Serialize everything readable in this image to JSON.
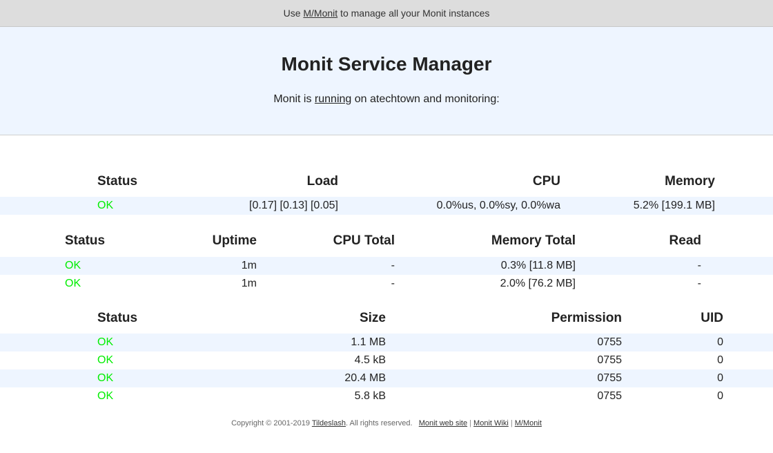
{
  "topbar": {
    "prefix": "Use ",
    "link": "M/Monit",
    "suffix": " to manage all your Monit instances"
  },
  "header": {
    "title": "Monit Service Manager",
    "sub_prefix": "Monit is ",
    "sub_link": "running",
    "sub_suffix": " on atechtown and monitoring:"
  },
  "system_table": {
    "headers": [
      "Status",
      "Load",
      "CPU",
      "Memory"
    ],
    "rows": [
      {
        "status": "OK",
        "load": "[0.17] [0.13] [0.05]",
        "cpu": "0.0%us, 0.0%sy, 0.0%wa",
        "memory": "5.2% [199.1 MB]"
      }
    ]
  },
  "process_table": {
    "headers": [
      "Status",
      "Uptime",
      "CPU Total",
      "Memory Total",
      "Read"
    ],
    "rows": [
      {
        "status": "OK",
        "uptime": "1m",
        "cpu_total": "-",
        "memory_total": "0.3% [11.8 MB]",
        "read": "-"
      },
      {
        "status": "OK",
        "uptime": "1m",
        "cpu_total": "-",
        "memory_total": "2.0% [76.2 MB]",
        "read": "-"
      }
    ]
  },
  "file_table": {
    "headers": [
      "Status",
      "Size",
      "Permission",
      "UID"
    ],
    "rows": [
      {
        "status": "OK",
        "size": "1.1 MB",
        "permission": "0755",
        "uid": "0"
      },
      {
        "status": "OK",
        "size": "4.5 kB",
        "permission": "0755",
        "uid": "0"
      },
      {
        "status": "OK",
        "size": "20.4 MB",
        "permission": "0755",
        "uid": "0"
      },
      {
        "status": "OK",
        "size": "5.8 kB",
        "permission": "0755",
        "uid": "0"
      }
    ]
  },
  "footer": {
    "copyright_prefix": "Copyright © 2001-2019 ",
    "copyright_link": "Tildeslash",
    "copyright_suffix": ". All rights reserved.",
    "links": [
      "Monit web site",
      "Monit Wiki",
      "M/Monit"
    ],
    "separator": "|"
  },
  "colors": {
    "status_ok": "#00ee00",
    "row_alt": "#eef5ff",
    "topbar_bg": "#dddddd"
  }
}
